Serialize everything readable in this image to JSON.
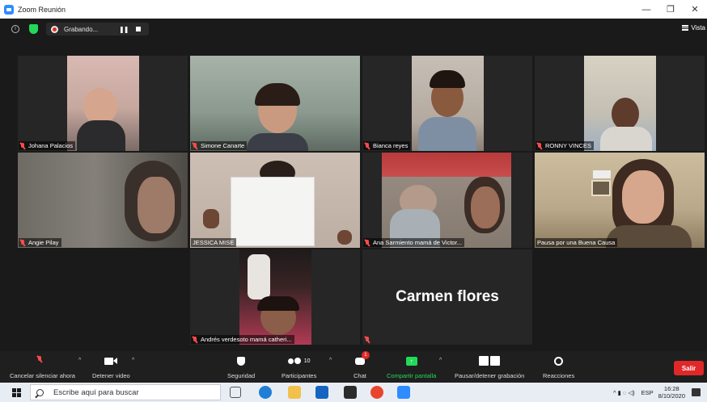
{
  "window": {
    "title": "Zoom Reunión",
    "minimize_glyph": "—",
    "restore_glyph": "❐",
    "close_glyph": "✕"
  },
  "topbar": {
    "info_glyph": "i",
    "recording_label": "Grabando...",
    "pause_glyph": "❚❚",
    "view_label": "Vista"
  },
  "participants": [
    {
      "name": "Johana Palacios",
      "muted": true,
      "video_bg": "#c9a9a0"
    },
    {
      "name": "Simone Canarte",
      "muted": true,
      "video_bg": "#8f9e94"
    },
    {
      "name": "Bianca reyes",
      "muted": true,
      "video_bg": "#b7ada4"
    },
    {
      "name": "RONNY VINCES",
      "muted": true,
      "video_bg": "#c8c2b5"
    },
    {
      "name": "Angie Pilay",
      "muted": true,
      "video_bg": "#6f6a62"
    },
    {
      "name": "JESSICA MISE",
      "muted": false,
      "video_bg": "#c4b7ad"
    },
    {
      "name": "Ana Sarmiento mamá de Victor...",
      "muted": true,
      "video_bg": "#8d8478"
    },
    {
      "name": "Pausa por una Buena Causa",
      "muted": false,
      "video_bg": "#b9a88c",
      "active": true
    },
    {
      "name": "Andrés verdesoto mamá catheri...",
      "muted": true,
      "video_bg": "#4a3a36"
    },
    {
      "name": "Carmen flores",
      "muted": true,
      "video_bg": "#262626",
      "video_off": true
    }
  ],
  "controls": {
    "unmute_label": "Cancelar silenciar ahora",
    "video_label": "Detener video",
    "security_label": "Seguridad",
    "participants_label": "Participantes",
    "participants_count": "10",
    "chat_label": "Chat",
    "chat_badge": "1",
    "share_label": "Compartir pantalla",
    "recording_label": "Pausar/detener grabación",
    "reactions_label": "Reacciones",
    "leave_label": "Salir",
    "caret_glyph": "^"
  },
  "taskbar": {
    "search_placeholder": "Escribe aquí para buscar",
    "language": "ESP",
    "time": "16:28",
    "date": "8/10/2020",
    "tray_glyphs": "^  ▮  ◌  ◁)"
  },
  "colors": {
    "accent_blue": "#2d8cff",
    "active_speaker": "#b5d66a",
    "leave_red": "#e02828",
    "share_green": "#23d959",
    "muted_red": "#ff4a4a"
  }
}
